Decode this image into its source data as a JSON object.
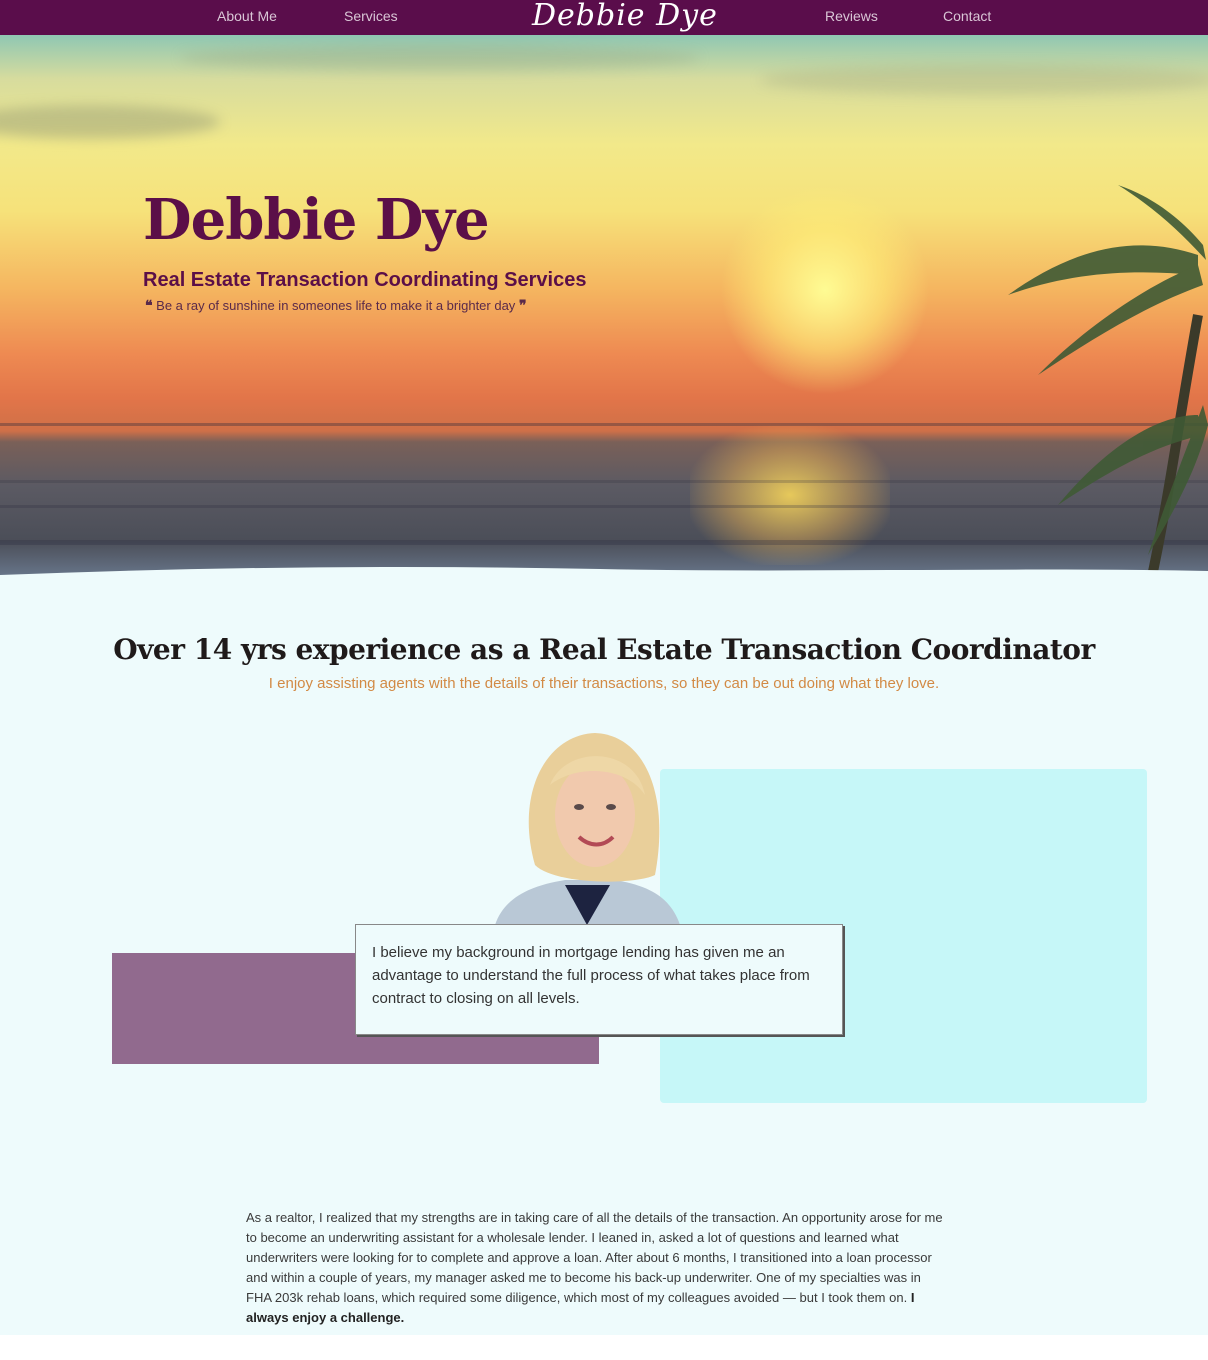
{
  "nav": {
    "links": [
      "About Me",
      "Services",
      "Reviews",
      "Contact"
    ],
    "logo": "Debbie Dye"
  },
  "hero": {
    "title": "Debbie Dye",
    "subtitle": "Real Estate Transaction Coordinating Services",
    "quote": "Be a ray of sunshine in someones life to make it a brighter day",
    "quote_open": "❝",
    "quote_close": "❞"
  },
  "intro": {
    "heading": "Over 14 yrs experience as a Real Estate Transaction Coordinator",
    "tagline": "I enjoy assisting agents with the details of their transactions, so they can be out doing what they love."
  },
  "card": {
    "text": "I believe my background in mortgage lending has given me an advantage to understand the full process of what takes place from contract to closing on all levels."
  },
  "bio": {
    "text": "As a realtor, I realized that my strengths are in taking care of all the details of the transaction. An opportunity arose for me to become an underwriting assistant for a wholesale lender. I leaned in, asked a lot of questions and learned what underwriters were looking for to complete and approve a loan. After about 6 months, I transitioned into a loan processor and within a couple of years, my manager asked me to become his back-up underwriter. One of my specialties was in FHA 203k rehab loans, which required some diligence, which most of my colleagues avoided — but I took them on.",
    "emphasis": "I always enjoy a challenge."
  },
  "colors": {
    "nav_bg": "#5a0d4b",
    "brand_purple": "#5b0f48",
    "accent_orange": "#d28a45",
    "cyan_panel": "#c6f7f8",
    "mauve_panel": "#916a8e",
    "page_bg": "#eefbfc"
  }
}
